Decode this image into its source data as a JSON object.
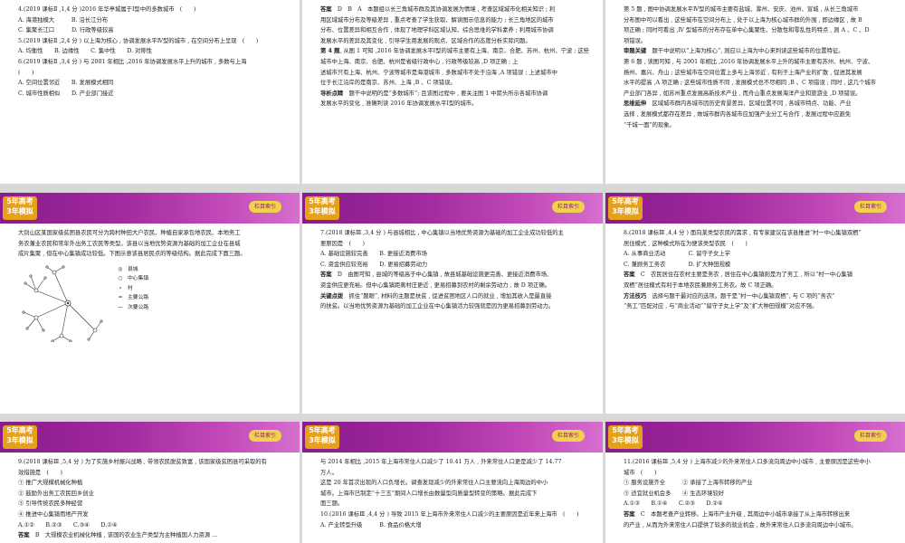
{
  "header": {
    "logo_line1": "5年高考",
    "logo_line2": "3年模拟",
    "button": "栏目索引"
  },
  "slides": {
    "s1": {
      "lines": [
        "4.(2019 课标Ⅱ ,1,4 分 )2016 年华亭城属于Ⅰ型中的多数城市　(　　)",
        "A. 海港独模大　　　B. 沿长江分布",
        "C. 集聚长江口　　　D. 行政等级较高",
        "5.(2019 课标Ⅱ ,2,4 分 ) 以上海为核心 , 协调发展水平Ⅳ型的城市 , 在空间分布上呈现　(　　)",
        "A. 均衡性　　B. 边缘性　　C. 集中性　　D. 对称性",
        "6.(2019 课标Ⅱ ,3,4 分 ) 与 2001 年相比 ,2016 年协调发展水平上升的城市 , 多数与上海",
        "(　　)",
        "A. 空间位置邻近　　B. 发展模式相同",
        "C. 城市性质相似　　D. 产业部门接近"
      ]
    },
    "s2": {
      "answer_label": "答案",
      "answer_text": "D　B　A　本题组以长三角城市群及其协调发展为情境 , 考查区域城市化相关知识 ; 利",
      "lines": [
        "用区域城市分布及等级差异 , 重点考查了学生获取、解读图示信息的能力 ; 长三角地区的城市",
        "分布、位置差异和相互合作 , 体现了地理学科区域认知、综合思维的学科素养 ; 利用城市协调",
        "发展水平的差异及其变化 , 引导学生用发展的观点、区域合作的态度分析实际问题。"
      ],
      "q4_label": "第 4 题",
      "q4_text": ", 从图 1 可知 ,2016 年协调发展水平Ⅰ型的城市主要有上海、南京、合肥、苏州、杭州、宁波 ; 这些城市中上海、南京、合肥、杭州是省级行政中心 , 行政等级较高 ,D 项正确 ; 上",
      "lines2": [
        "述城市只有上海、杭州、宁波等城市是海港城市 , 多数城市不处于沿海 ,A 项错误 ; 上述城市中",
        "位于长江沿岸的是南京、苏州、上海 ,B 、C 项错误。"
      ],
      "tip_label": "导析点睛",
      "tip_text": "题干中说明的是“多数城市”; 且该图过程中 , 要关注图 1 中箭头所示各城市协调",
      "tip_line2": "发展水平的变化 , 准确判读 2016 年协调发展水平Ⅰ型的城市。"
    },
    "s3": {
      "lines": [
        "第 5 题 , 图中协调发展水平Ⅳ型的城市主要有盐城、滁州、安庆、池州、宣城 , 从长三角城市",
        "分布图中可以看出 , 这些城市在空间分布上 , 处于以上海为核心城市群的外围 , 即边缘区 , 故 B",
        "项正确 ; 同时可看出 ,Ⅳ 型城市的分布存在单中心集聚性、分散性和零乱性的特点 , 则 A 、C 、D",
        "项错误。"
      ],
      "review_label": "审题关键",
      "review_text": "题干中说明以“上海为核心”, 则应以上海为中心来判读这些城市的位置特征。",
      "q6_lines": [
        "第 6 题 , 读图可知 , 与 2001 年相比 ,2016 年协调发展水平上升的城市主要有苏州、杭州、宁波、",
        "扬州、嘉兴、舟山 ; 这些城市在空间位置上多与上海邻近 , 有利于上海产业的扩散 , 促进其发展",
        "水平的提高 ,A 项正确 ; 这些城市性质不同 , 发展模式也不尽相同 ,B 、C 项错误 ; 同时 , 这几个城市",
        "产业部门各异 , 如苏州重点发展高新技术产业 , 而舟山重点发展海洋产业和旅游业 ,D 项错误。"
      ],
      "ext_label": "思维延伸",
      "ext_text": "区域城市群内各城市因历史背景差异、区域位置不同 , 各城市特点、功能、产业",
      "ext_lines": [
        "选择 , 发展模式都存在差异 , 故城市群内各城市应加强产业分工与合作 , 发展过程中应避免",
        "“千城一面”的现象。"
      ]
    },
    "s4": {
      "lines": [
        "大别山区某国家级贫困县农民可分为跨村种田大户农民、种植自家承包地农民、本地务工",
        "务农兼业农民和常年外出务工农民等类型。该县以当地优势资源为基础的加工企业在县城",
        "成片集聚 , 但在中心集镇成功较低。下图示意该县居民点的等级结构。据此完成下面三题。"
      ],
      "legend": [
        {
          "sym": "◎",
          "label": "县城"
        },
        {
          "sym": "○",
          "label": "中心集镇"
        },
        {
          "sym": "∘",
          "label": "村"
        },
        {
          "sym": "━",
          "label": "主要公路"
        },
        {
          "sym": "—",
          "label": "次要公路"
        }
      ]
    },
    "s5": {
      "lines": [
        "7.(2018 课标Ⅲ ,3,4 分 ) 与县城相比 , 中心集镇以当地优势资源为基础的加工企业成功较低的主",
        "要原因是　(　　)",
        "A. 基础设施较完善　　B. 更接近消费市场",
        "C. 资金供应较充裕　　D. 更易招募劳动力"
      ],
      "answer_label": "答案",
      "answer_text": "D　由图可知 , 县城的等级高于中心集镇 , 故县城基础设施更完善、更接近消费市场、",
      "answer_line2": "资金供应更充裕。但中心集镇距离村庄更近 , 更易招募到农村的剩余劳动力 , 故 D 项正确。",
      "key_label": "关键点拨",
      "key_text": "抓住“题眼”, 材料的主题是扶贫 , 促进贫困地区人口的就业 , 增加其收入是最直接",
      "key_line2": "的扶贫。以当地优势资源为基础的加工企业在中心集镇活力较强就是因为更易招募到劳动力。"
    },
    "s6": {
      "lines": [
        "8.(2018 课标Ⅲ ,4,4 分 ) 面向某类型农民的需求 , 有专家建议在该县推进“村一中心集镇双栖”",
        "居住模式 , 这种模式所在为便该类型农民　(　　)",
        "A. 从事商业活动　　　　C. 留守子女上学",
        "C. 兼顾务工务农　　　　D. 扩大种田规模"
      ],
      "answer_label": "答案",
      "answer_text": "C　农民居住在农村主要是务农 , 居住在中心集镇则是为了务工 , 所以“村一中心集镇",
      "answer_line2": "双栖”居住模式有利于本地农民兼顾务工务农。故 C 项正确。",
      "method_label": "方法技巧",
      "method_text": "选择与题干最对应的选项。题干是“村一中心集镇双栖”, 与 C 项的“务农”",
      "method_line2": "“务工”匹配对应 , 与“商业活动”“留守子女上学”及“扩大种田规模”对应不强。"
    },
    "s7": {
      "lines": [
        "9.(2018 课标Ⅲ ,5,4 分 ) 为了实施乡村振兴战略 , 带领农民脱贫致富 , 该国家级贫困县可采取的有",
        "效措施是　(　　)",
        "① 推广大规模机械化种植",
        "② 鼓励外出务工农民回乡创业",
        "③ 引导传统农民多种经营",
        "④ 推进中心集镇而地产开发",
        "A.①②　　B.②③　　C.③④　　D.①④"
      ],
      "answer_label": "答案",
      "answer_text": "B　大规模农业机械化种植 , 该国的农业生产类型为主种植国人力资源 ..."
    },
    "s8": {
      "lines": [
        "与 2014 年相比 ,2015 年上海市常住人口减少了 10.41 万人 , 外来常住人口更是减少了 14.77",
        "万人。",
        "这是 20 年首次出现的人口负增长。调查发现减少的外来常住人口主要流向上海周边的中小",
        "城市。上海市已制定“十三五”期间人口增长由数量型向质量型转变的策略。据此完成下",
        "面三题。",
        "10.(2016 课标Ⅲ ,4,4 分 ) 导致 2015 年上海市外来常住人口减少的主要原因是近年来上海市　(　　)",
        "A. 产业转型升级　　　B. 食品价格大增"
      ]
    },
    "s9": {
      "lines": [
        "11.(2016 课标Ⅲ ,5,4 分 ) 上海市减少的外来常住人口多流向周边中小城市 , 主要原因是这些中小",
        "城市　(　　)",
        "① 服务设施齐全　　　② 承接了上海市转移的产业",
        "③ 适宜就业机会多　　④ 生态环境较好",
        "A.①③　　B.①④　　C.②③　　D.②④"
      ],
      "answer_label": "答案",
      "answer_text": "C　本题考查产业转移。上海市产业升级 , 其周边中小城市承接了从上海市转移出来",
      "answer_line2": "的产业 , 从而为外来常住人口提供了较多的就业机会 , 故外来常住人口多流向周边中小城市。"
    }
  }
}
